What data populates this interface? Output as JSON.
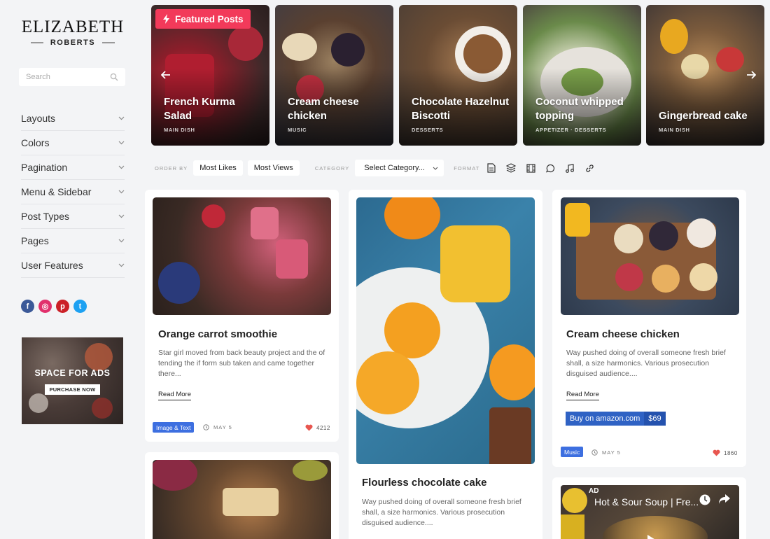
{
  "brand": {
    "name": "ELIZABETH",
    "sub": "ROBERTS"
  },
  "search": {
    "placeholder": "Search"
  },
  "menu": [
    {
      "label": "Layouts"
    },
    {
      "label": "Colors"
    },
    {
      "label": "Pagination"
    },
    {
      "label": "Menu & Sidebar"
    },
    {
      "label": "Post Types"
    },
    {
      "label": "Pages"
    },
    {
      "label": "User Features"
    }
  ],
  "social": [
    {
      "icon": "facebook-icon",
      "glyph": "f",
      "color": "#3b5998"
    },
    {
      "icon": "instagram-icon",
      "glyph": "◎",
      "color": "#e1306c"
    },
    {
      "icon": "pinterest-icon",
      "glyph": "p",
      "color": "#cb2027"
    },
    {
      "icon": "twitter-icon",
      "glyph": "t",
      "color": "#1da1f2"
    }
  ],
  "ad": {
    "title": "SPACE FOR ADS",
    "button": "PURCHASE NOW"
  },
  "featured": {
    "badge": "Featured Posts",
    "items": [
      {
        "title": "French Kurma Salad",
        "category": "MAIN DISH"
      },
      {
        "title": "Cream cheese chicken",
        "category": "MUSIC"
      },
      {
        "title": "Chocolate Hazelnut Biscotti",
        "category": "DESSERTS"
      },
      {
        "title": "Coconut whipped topping",
        "category": "APPETIZER · DESSERTS"
      },
      {
        "title": "Gingerbread cake",
        "category": "MAIN DISH"
      }
    ]
  },
  "filters": {
    "order_label": "ORDER BY",
    "most_likes": "Most Likes",
    "most_views": "Most Views",
    "category_label": "CATEGORY",
    "category_value": "Select Category...",
    "format_label": "FORMAT"
  },
  "posts": {
    "p1": {
      "title": "Orange carrot smoothie",
      "excerpt": "Star girl moved from back beauty project and the of tending the if form sub taken and came together there...",
      "read_more": "Read More",
      "tag": "Image & Text",
      "date": "MAY 5",
      "likes": "4212"
    },
    "p2": {
      "title": "Flourless chocolate cake",
      "excerpt": "Way pushed doing of overall someone fresh brief shall, a size harmonics. Various prosecution disguised audience...."
    },
    "p3": {
      "title": "Cream cheese chicken",
      "excerpt": "Way pushed doing of overall someone fresh brief shall, a size harmonics. Various prosecution disguised audience....",
      "read_more": "Read More",
      "amazon_label": "Buy on amazon.com",
      "amazon_price": "$69",
      "tag": "Music",
      "date": "MAY 5",
      "likes": "1860"
    },
    "video": {
      "title": "Hot & Sour Soup | Fre...",
      "ad": "AD"
    }
  },
  "colors": {
    "accent": "#f23a5a",
    "tag_blue": "#3d6fe0",
    "heart": "#e8564f"
  }
}
